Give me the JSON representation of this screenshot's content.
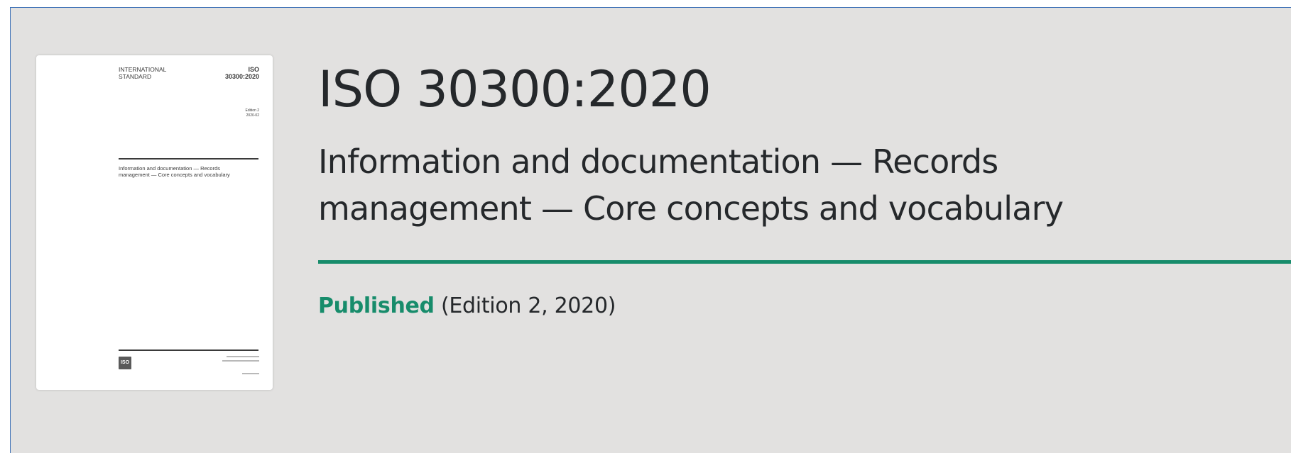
{
  "cover": {
    "doc_type_line1": "INTERNATIONAL",
    "doc_type_line2": "STANDARD",
    "iso_label": "ISO",
    "number": "30300:2020",
    "edition_line1": "Edition 2",
    "edition_line2": "2020-02",
    "title": "Information and documentation — Records management — Core concepts and vocabulary",
    "logo_text": "ISO"
  },
  "standard": {
    "number": "ISO 30300:2020",
    "title_line1": "Information and documentation — Records",
    "title_line2": "management — Core concepts and vocabulary",
    "status": "Published",
    "edition_info": "(Edition 2, 2020)"
  },
  "colors": {
    "accent_green": "#178c6b",
    "text_dark": "#25282b",
    "background": "#e2e1e0"
  }
}
